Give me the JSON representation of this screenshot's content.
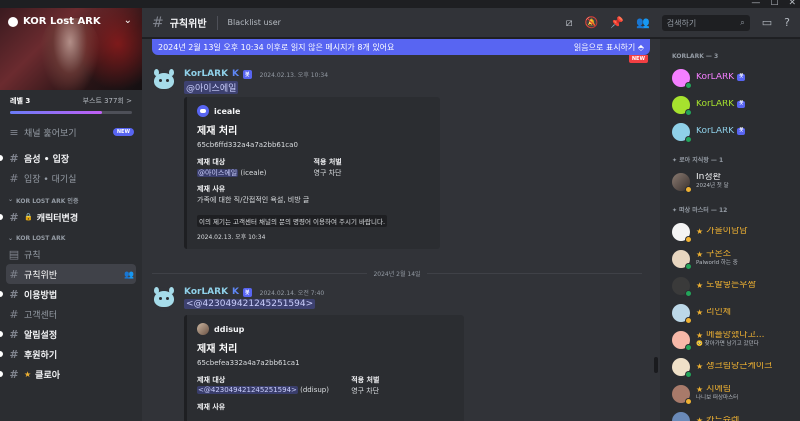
{
  "window": {
    "minimize": "—",
    "maximize": "☐",
    "close": "✕"
  },
  "server": {
    "name": "KOR Lost ARK",
    "level": "레벨 3",
    "boost": "부스트 377회 >",
    "boost_fraction": 0.75
  },
  "sidebar": {
    "channels_top": [
      {
        "label": "채널 훑어보기",
        "badge": "NEW",
        "icon": "browse-channels-icon"
      },
      {
        "label": "음성 • 입장",
        "bright": true
      },
      {
        "label": "입장 • 대기실"
      }
    ],
    "cat1": "KOR LOST ARK 인증",
    "cat1_channels": [
      {
        "label": "캐릭터변경",
        "bright": true
      }
    ],
    "cat2": "KOR LOST ARK",
    "cat2_channels": [
      {
        "label": "규칙"
      },
      {
        "label": "규칙위반",
        "active": true
      },
      {
        "label": "이용방법",
        "bright": true
      },
      {
        "label": "고객센터"
      },
      {
        "label": "알림설정",
        "bright": true
      },
      {
        "label": "후원하기",
        "bright": true
      },
      {
        "label": "클로아",
        "bright": true
      }
    ]
  },
  "header": {
    "channel": "규칙위반",
    "topic": "Blacklist user",
    "search_placeholder": "검색하기"
  },
  "unread": {
    "text": "2024년 2월 13일 오후 10:34 이후로 읽지 않은 메시지가 8개 있어요",
    "action": "읽음으로 표시하기",
    "new_tag": "NEW"
  },
  "messages": [
    {
      "author": "KorLARK",
      "bot": "봇",
      "timestamp": "2024.02.13. 오후 10:34",
      "mention": "@아이스에일",
      "embed": {
        "author": "iceale",
        "title": "제재 처리",
        "id": "65cb6ffd332a4a7a2bb61ca0",
        "target_label": "제재 대상",
        "target_mention": "@아이스에일",
        "target_rest": " (iceale)",
        "penalty_label": "적용 처벌",
        "penalty": "영구 차단",
        "reason_label": "제재 사유",
        "reason": "가족에 대한 직/간접적인 욕설, 비방 글",
        "note": "이의 제기는 고객센터 채널의 문의 명령어 이용하여 주시기 바랍니다.",
        "footer": "2024.02.13. 오후 10:34"
      }
    },
    {
      "author": "KorLARK",
      "bot": "봇",
      "timestamp": "2024.02.14. 오전 7:40",
      "mention": "<@423049421245251594>",
      "embed": {
        "author": "ddisup",
        "title": "제재 처리",
        "id": "65cbefea332a4a7a2bb61ca1",
        "target_label": "제재 대상",
        "target_mention": "<@423049421245251594>",
        "target_rest": " (ddisup)",
        "penalty_label": "적용 처벌",
        "penalty": "영구 차단",
        "reason_label": "제재 사유"
      }
    }
  ],
  "date_separator": "2024년 2월 14일",
  "members": {
    "cat_bots": "KORLARK — 3",
    "bots": [
      {
        "name": "KorLARK",
        "tag": "봇",
        "color": "#f47fff"
      },
      {
        "name": "KorLARK",
        "tag": "봇",
        "color": "#a6e22e"
      },
      {
        "name": "KorLARK",
        "tag": "봇",
        "color": "#8fd0e8"
      }
    ],
    "cat_knowledge": "로아 지식왕 — 1",
    "knowledge": [
      {
        "name": "In청환",
        "sub": "2024년 첫 달"
      }
    ],
    "cat_master": "떠상 마스터 — 12",
    "masters": [
      {
        "name": "가을이남남",
        "sub": ""
      },
      {
        "name": "구온소",
        "sub": "Palworld 하는 중"
      },
      {
        "name": "도발넣는우짬",
        "sub": ""
      },
      {
        "name": "리인체",
        "sub": ""
      },
      {
        "name": "메플망했다고...",
        "sub": "🥺 찾아가면 남기고 갔던다"
      },
      {
        "name": "생크림당근케이크",
        "sub": ""
      },
      {
        "name": "지에림",
        "sub": "나니보 떠상마스터"
      },
      {
        "name": "카드슈레",
        "sub": ""
      }
    ]
  }
}
